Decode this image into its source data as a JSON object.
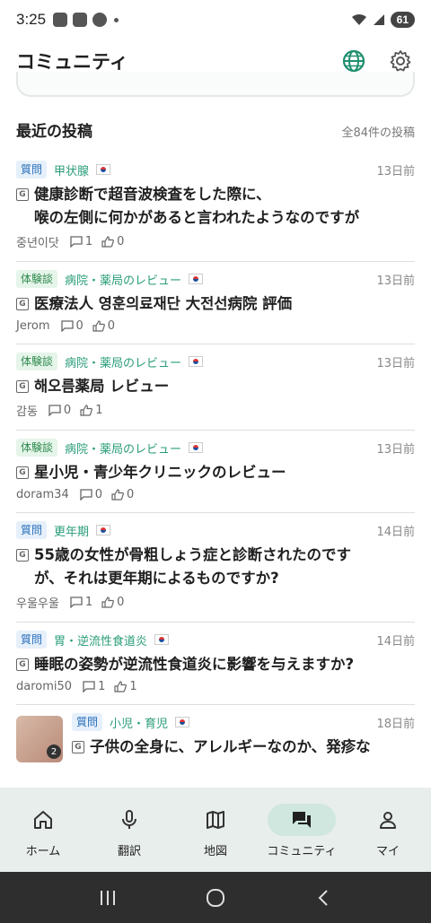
{
  "status_bar": {
    "time": "3:25",
    "battery": "61"
  },
  "header": {
    "title": "コミュニティ",
    "icons": [
      "globe-icon",
      "gear-icon"
    ]
  },
  "section": {
    "title": "最近の投稿",
    "count": "全84件の投稿"
  },
  "posts": [
    {
      "type": "質問",
      "category": "甲状腺",
      "date": "13日前",
      "title_line1": "健康診断で超音波検査をした際に、",
      "title_line2": "喉の左側に何かがあると言われたようなのですが",
      "author": "중년이닷",
      "comments": "1",
      "likes": "0"
    },
    {
      "type": "体験談",
      "category": "病院・薬局のレビュー",
      "date": "13日前",
      "title_line1": "医療法人 영훈의료재단 大전선病院 評価",
      "author": "Jerom",
      "comments": "0",
      "likes": "0"
    },
    {
      "type": "体験談",
      "category": "病院・薬局のレビュー",
      "date": "13日前",
      "title_line1": "해오름薬局 レビュー",
      "author": "감동",
      "comments": "0",
      "likes": "1"
    },
    {
      "type": "体験談",
      "category": "病院・薬局のレビュー",
      "date": "13日前",
      "title_line1": "星小児・青少年クリニックのレビュー",
      "author": "doram34",
      "comments": "0",
      "likes": "0"
    },
    {
      "type": "質問",
      "category": "更年期",
      "date": "14日前",
      "title_line1": "55歳の女性が骨粗しょう症と診断されたのです",
      "title_line2": "が、それは更年期によるものですか?",
      "author": "우울우울",
      "comments": "1",
      "likes": "0"
    },
    {
      "type": "質問",
      "category": "胃・逆流性食道炎",
      "date": "14日前",
      "title_line1": "睡眠の姿勢が逆流性食道炎に影響を与えますか?",
      "author": "daromi50",
      "comments": "1",
      "likes": "1"
    },
    {
      "type": "質問",
      "category": "小児・育児",
      "date": "18日前",
      "title_line1": "子供の全身に、アレルギーなのか、発疹な",
      "thumb_count": "2"
    }
  ],
  "bottom_nav": [
    {
      "label": "ホーム",
      "icon": "home-icon"
    },
    {
      "label": "翻訳",
      "icon": "microphone-icon"
    },
    {
      "label": "地図",
      "icon": "map-icon"
    },
    {
      "label": "コミュニティ",
      "icon": "forum-icon"
    },
    {
      "label": "マイ",
      "icon": "person-icon"
    }
  ],
  "colors": {
    "accent_green": "#2a9d7a",
    "question_tag_text": "#2a6fb8",
    "experience_tag_text": "#2e8a4e",
    "nav_bg": "#e8eeec",
    "nav_active": "#cfe7df"
  }
}
